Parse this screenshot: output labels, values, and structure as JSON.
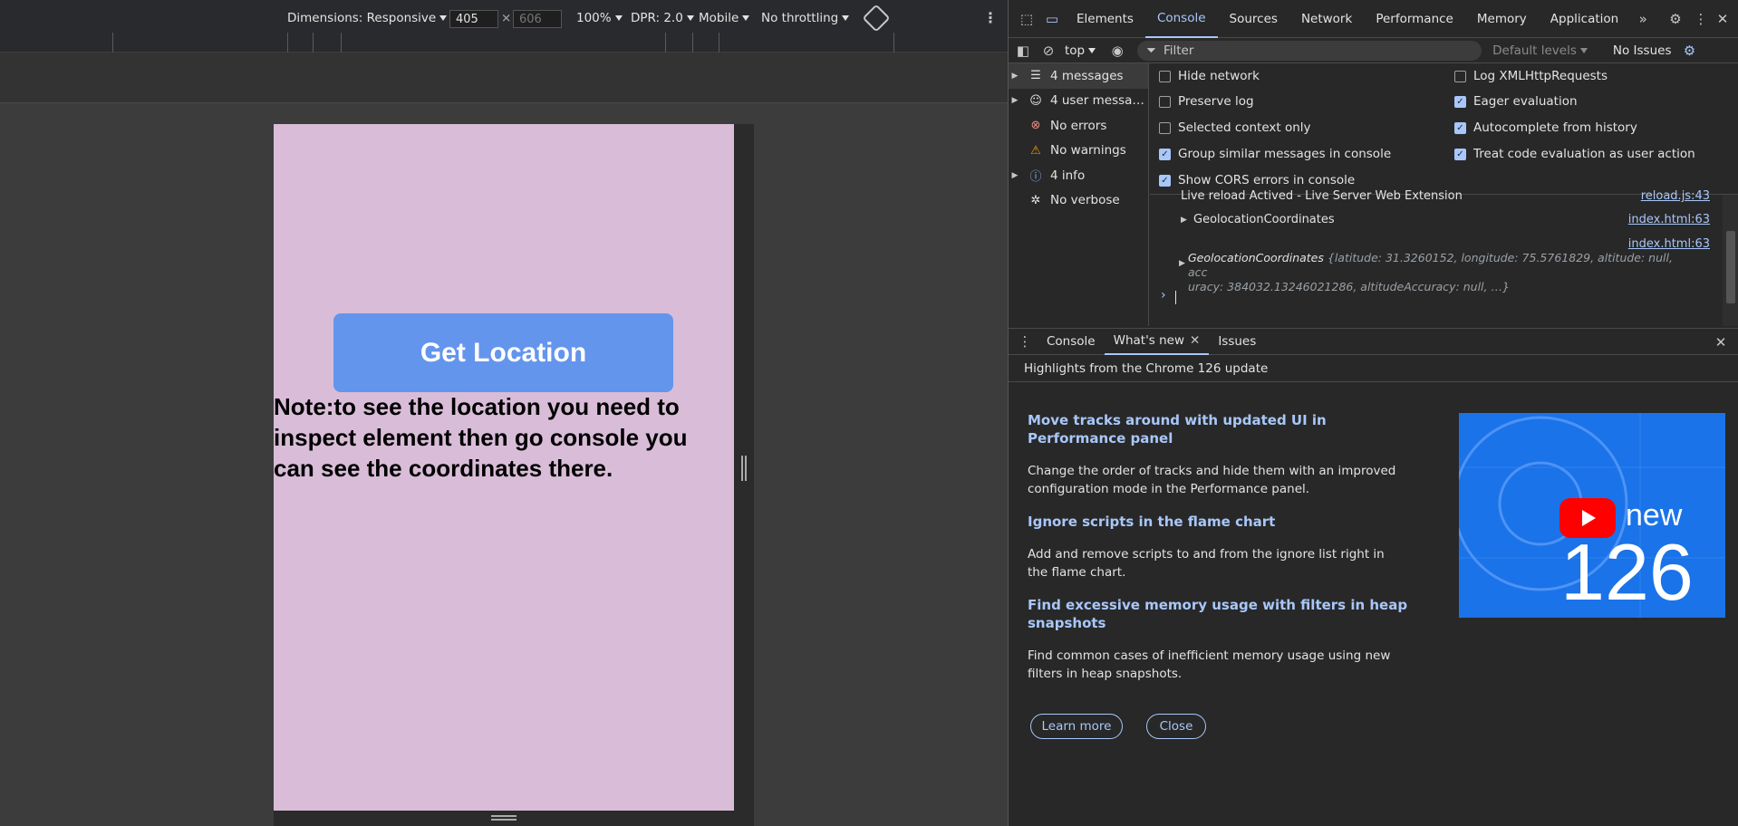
{
  "emulation_toolbar": {
    "dimensions_label": "Dimensions: Responsive",
    "width_value": "405",
    "height_placeholder": "606",
    "times_sign": "×",
    "zoom": "100%",
    "dpr": "DPR: 2.0",
    "device_type": "Mobile",
    "throttling": "No throttling"
  },
  "page": {
    "button_label": "Get Location",
    "note_text": "Note:to see the location you need to inspect element then go console you can see the coordinates there."
  },
  "devtools": {
    "tabs": [
      "Elements",
      "Console",
      "Sources",
      "Network",
      "Performance",
      "Memory",
      "Application"
    ],
    "active_tab": "Console",
    "more_tabs": "»",
    "context": "top",
    "filter_placeholder": "Filter",
    "levels": "Default levels",
    "issues": "No Issues",
    "sidebar": [
      {
        "label": "4 messages",
        "icon": "list-icon",
        "expandable": true
      },
      {
        "label": "4 user messa…",
        "icon": "user-icon",
        "expandable": true
      },
      {
        "label": "No errors",
        "icon": "error-icon",
        "expandable": false
      },
      {
        "label": "No warnings",
        "icon": "warning-icon",
        "expandable": false
      },
      {
        "label": "4 info",
        "icon": "info-icon",
        "expandable": true
      },
      {
        "label": "No verbose",
        "icon": "bug-icon",
        "expandable": false
      }
    ],
    "settings_left": [
      {
        "label": "Hide network",
        "checked": false
      },
      {
        "label": "Preserve log",
        "checked": false
      },
      {
        "label": "Selected context only",
        "checked": false
      },
      {
        "label": "Group similar messages in console",
        "checked": true
      },
      {
        "label": "Show CORS errors in console",
        "checked": true
      }
    ],
    "settings_right": [
      {
        "label": "Log XMLHttpRequests",
        "checked": false
      },
      {
        "label": "Eager evaluation",
        "checked": true
      },
      {
        "label": "Autocomplete from history",
        "checked": true
      },
      {
        "label": "Treat code evaluation as user action",
        "checked": true
      }
    ],
    "console_lines": {
      "live_reload": "Live reload Actived - Live Server Web Extension",
      "live_reload_src": "reload.js:43",
      "geo1": "GeolocationCoordinates",
      "geo1_src": "index.html:63",
      "geo2_src": "index.html:63",
      "geo2_name": "GeolocationCoordinates",
      "geo2_line1": "{latitude: 31.3260152, longitude: 75.5761829, altitude: null, acc",
      "geo2_line2": "uracy: 384032.13246021286, altitudeAccuracy: null, …}",
      "prompt": "›"
    },
    "drawer_tabs": [
      "Console",
      "What's new",
      "Issues"
    ],
    "drawer_active": "What's new",
    "whats_new_header": "Highlights from the Chrome 126 update",
    "features": [
      {
        "title": "Move tracks around with updated UI in Performance panel",
        "desc": "Change the order of tracks and hide them with an improved configuration mode in the Performance panel."
      },
      {
        "title": "Ignore scripts in the flame chart",
        "desc": "Add and remove scripts to and from the ignore list right in the flame chart."
      },
      {
        "title": "Find excessive memory usage with filters in heap snapshots",
        "desc": "Find common cases of inefficient memory usage using new filters in heap snapshots."
      }
    ],
    "learn_more": "Learn more",
    "close": "Close",
    "promo_new": "new",
    "promo_version": "126"
  },
  "colors": {
    "page_bg": "#d9bdd8",
    "button_bg": "#6495ed",
    "accent": "#a8c7fa"
  }
}
